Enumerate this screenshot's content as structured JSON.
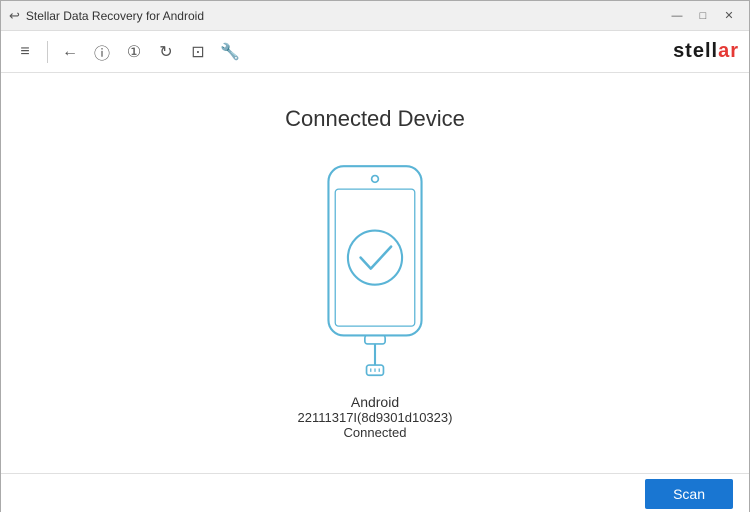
{
  "titlebar": {
    "icon": "↩",
    "title": "Stellar Data Recovery for Android",
    "min_btn": "—",
    "max_btn": "□",
    "close_btn": "✕"
  },
  "toolbar": {
    "menu_icon": "≡",
    "back_icon": "←",
    "info_icon": "ⓘ",
    "help_icon": "①",
    "refresh_icon": "↻",
    "cart_icon": "⊡",
    "settings_icon": "🔧"
  },
  "brand": {
    "text_black": "stell",
    "text_red": "ar"
  },
  "main": {
    "title": "Connected Device",
    "device_name": "Android",
    "device_id": "22111317I(8d9301d10323)",
    "device_status": "Connected"
  },
  "footer": {
    "scan_label": "Scan"
  }
}
